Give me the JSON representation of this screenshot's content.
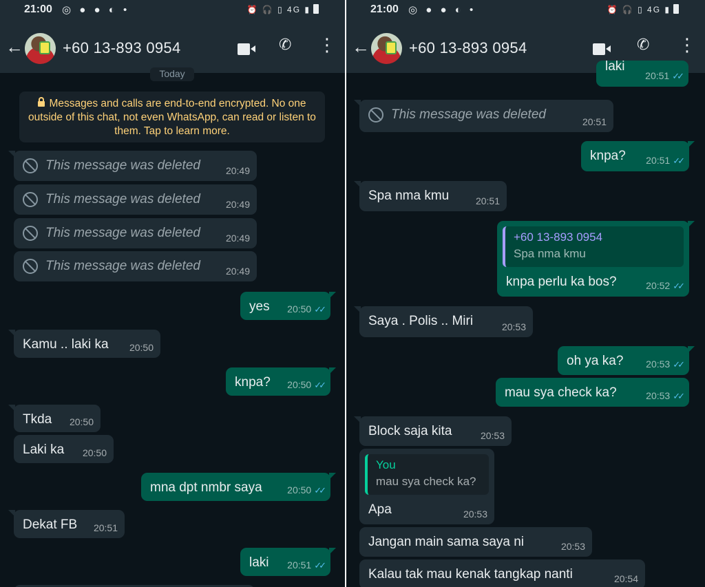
{
  "status": {
    "time": "21:00",
    "network": "4G"
  },
  "contact": {
    "name": "+60 13-893 0954"
  },
  "left": {
    "date_chip": "Today",
    "encryption_note": "Messages and calls are end-to-end encrypted. No one outside of this chat, not even WhatsApp, can read or listen to them. Tap to learn more.",
    "messages": [
      {
        "text": "This message was deleted",
        "time": "20:49"
      },
      {
        "text": "This message was deleted",
        "time": "20:49"
      },
      {
        "text": "This message was deleted",
        "time": "20:49"
      },
      {
        "text": "This message was deleted",
        "time": "20:49"
      },
      {
        "text": "yes",
        "time": "20:50"
      },
      {
        "text": "Kamu .. laki ka",
        "time": "20:50"
      },
      {
        "text": "knpa?",
        "time": "20:50"
      },
      {
        "text": "Tkda",
        "time": "20:50"
      },
      {
        "text": "Laki ka",
        "time": "20:50"
      },
      {
        "text": "mna dpt nmbr saya",
        "time": "20:50"
      },
      {
        "text": "Dekat FB",
        "time": "20:51"
      },
      {
        "text": "laki",
        "time": "20:51"
      }
    ]
  },
  "right": {
    "messages": [
      {
        "text": "laki",
        "time": "20:51"
      },
      {
        "text": "This message was deleted",
        "time": "20:51"
      },
      {
        "text": "knpa?",
        "time": "20:51"
      },
      {
        "text": "Spa nma kmu",
        "time": "20:51"
      },
      {
        "quote_author": "+60 13-893 0954",
        "quote_text": "Spa nma kmu",
        "text": "knpa perlu ka bos?",
        "time": "20:52"
      },
      {
        "text": "Saya . Polis .. Miri",
        "time": "20:53"
      },
      {
        "text": "oh ya ka?",
        "time": "20:53"
      },
      {
        "text": "mau sya check ka?",
        "time": "20:53"
      },
      {
        "text": "Block saja kita",
        "time": "20:53"
      },
      {
        "quote_author": "You",
        "quote_text": "mau sya check ka?",
        "text": "Apa",
        "time": "20:53"
      },
      {
        "text": "Jangan main sama saya ni",
        "time": "20:53"
      },
      {
        "text": "Kalau tak mau kenak tangkap nanti",
        "time": "20:54"
      }
    ]
  }
}
